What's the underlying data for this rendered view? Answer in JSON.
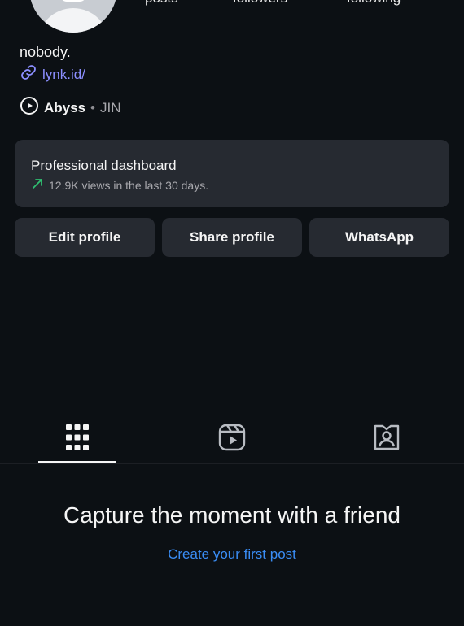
{
  "header": {
    "stats": [
      {
        "label": "posts"
      },
      {
        "label": "followers"
      },
      {
        "label": "following"
      }
    ]
  },
  "bio": {
    "name_text": "nobody.",
    "link_text": "lynk.id/",
    "link_icon": "link-icon"
  },
  "music": {
    "icon": "play-circle-icon",
    "song": "Abyss",
    "separator": "•",
    "artist": "JIN"
  },
  "dashboard": {
    "title": "Professional dashboard",
    "subtitle": "12.9K views in the last 30 days.",
    "trend_icon": "trend-up-arrow-icon",
    "trend_color": "#2fbf71"
  },
  "actions": {
    "edit_profile": "Edit profile",
    "share_profile": "Share profile",
    "whatsapp": "WhatsApp"
  },
  "tabs": [
    {
      "name": "posts-grid",
      "icon": "grid-icon",
      "selected": true
    },
    {
      "name": "reels",
      "icon": "reels-icon",
      "selected": false
    },
    {
      "name": "tagged",
      "icon": "tagged-person-icon",
      "selected": false
    }
  ],
  "empty_state": {
    "title": "Capture the moment with a friend",
    "link": "Create your first post"
  },
  "colors": {
    "background": "#0c1014",
    "card": "#262a31",
    "link": "#3a8df5",
    "bio_link": "#8c8fff"
  }
}
